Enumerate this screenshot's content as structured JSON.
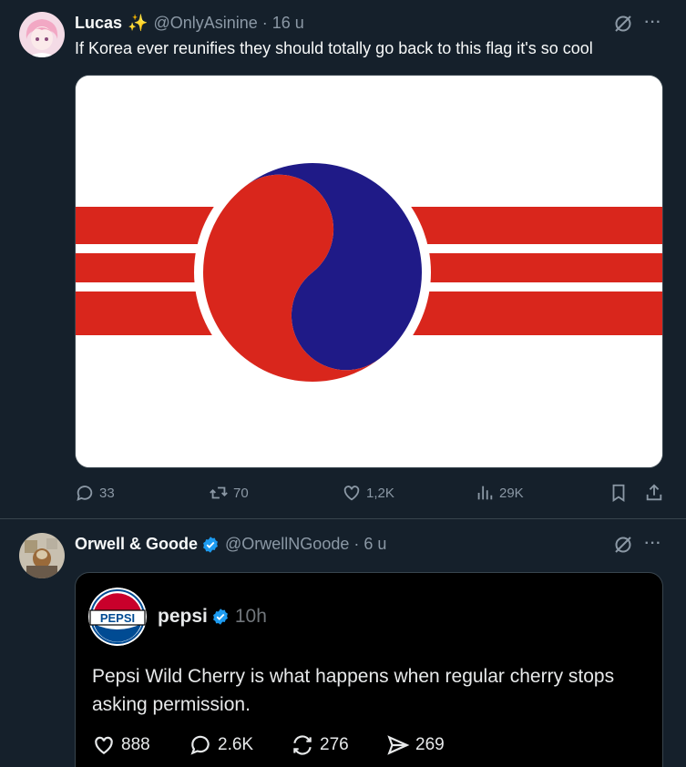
{
  "tweets": [
    {
      "name": "Lucas",
      "handle": "@OnlyAsinine · 16 u",
      "text": "If Korea ever reunifies they should totally go back to this flag it's so cool",
      "stats": {
        "replies": "33",
        "reposts": "70",
        "likes": "1,2K",
        "views": "29K"
      }
    },
    {
      "name": "Orwell & Goode",
      "handle": "@OrwellNGoode · 6 u",
      "quote": {
        "logo_text": "PEPSI",
        "name": "pepsi",
        "time": "10h",
        "text": "Pepsi Wild Cherry is what happens when regular cherry stops asking permission.",
        "stats": {
          "likes": "888",
          "replies": "2.6K",
          "reposts": "276",
          "shares": "269"
        }
      }
    }
  ],
  "icons": {
    "sparkle": "sparkles-icon",
    "verified": "verified-badge-icon",
    "grok": "grok-icon",
    "more": "more-icon"
  },
  "colors": {
    "background": "#15202b",
    "text_secondary": "#8b98a5",
    "verified_blue": "#1d9bf0",
    "flag_red": "#d9261c",
    "flag_blue": "#1f1a87",
    "pepsi_red": "#c9002b",
    "pepsi_blue": "#004b93"
  }
}
